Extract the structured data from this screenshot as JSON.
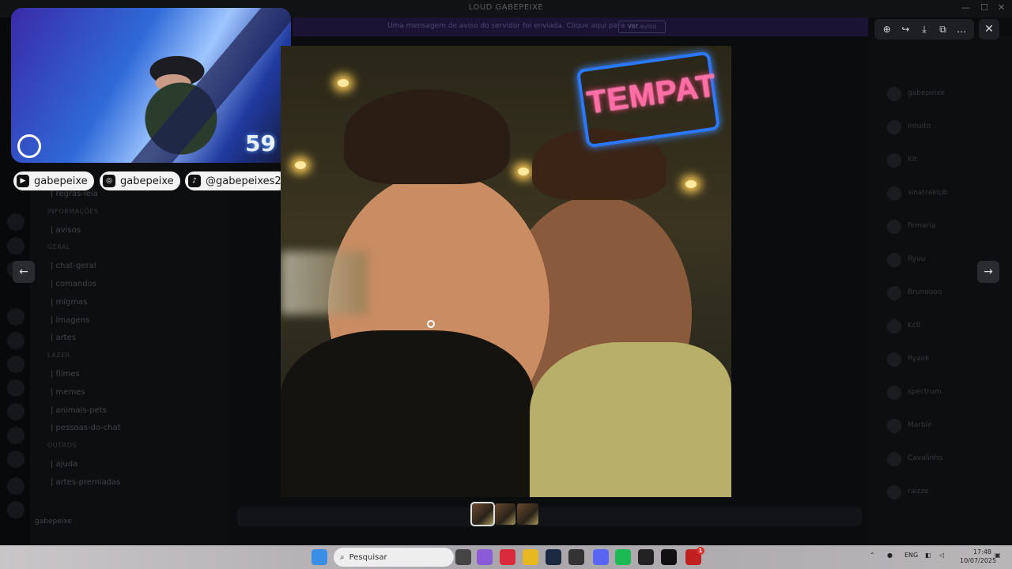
{
  "window": {
    "title": "LOUD GABEPEIXE",
    "minimize": "—",
    "maximize": "☐",
    "close": "✕"
  },
  "background": {
    "banner_text": "Uma mensagem de aviso do servidor foi enviada. Clique aqui para ver.",
    "banner_button": "Ver aviso",
    "channels": [
      {
        "label": "| regras-leia",
        "category": false
      },
      {
        "label": "INFORMAÇÕES",
        "category": true
      },
      {
        "label": "| avisos",
        "category": false
      },
      {
        "label": "GERAL",
        "category": true
      },
      {
        "label": "| chat-geral",
        "category": false
      },
      {
        "label": "| comandos",
        "category": false
      },
      {
        "label": "| mígmas",
        "category": false
      },
      {
        "label": "| imagens",
        "category": false
      },
      {
        "label": "| artes",
        "category": false
      },
      {
        "label": "LAZER",
        "category": true
      },
      {
        "label": "| filmes",
        "category": false
      },
      {
        "label": "| memes",
        "category": false
      },
      {
        "label": "| animais-pets",
        "category": false
      },
      {
        "label": "| pessoas-do-chat",
        "category": false
      },
      {
        "label": "OUTROS",
        "category": true
      },
      {
        "label": "| ajuda",
        "category": false
      },
      {
        "label": "| artes-premiadas",
        "category": false
      }
    ],
    "user_name": "gabepeixe",
    "members": [
      "gabepeixe",
      "Intuito",
      "Kit",
      "sinatraklub",
      "firmaria",
      "Ryuu",
      "Brunoooo",
      "Kcll",
      "Ryaok",
      "spectrum",
      "Marble",
      "Cavalinho",
      "raizzo"
    ]
  },
  "webcam": {
    "counter": "59"
  },
  "socials": [
    {
      "icon": "youtube-icon",
      "glyph": "▶",
      "handle": "gabepeixe"
    },
    {
      "icon": "instagram-icon",
      "glyph": "◎",
      "handle": "gabepeixe"
    },
    {
      "icon": "tiktok-icon",
      "glyph": "♪",
      "handle": "@gabepeixes2"
    }
  ],
  "image": {
    "neon_text": "TEMPAT"
  },
  "viewer": {
    "zoom": "⊕",
    "forward": "↪",
    "download": "⤓",
    "open": "⧉",
    "more": "…",
    "close": "✕",
    "prev": "←",
    "next": "→"
  },
  "taskbar": {
    "search_placeholder": "Pesquisar",
    "language": "ENG",
    "time": "17:48",
    "date": "10/07/2025",
    "badge": "1"
  }
}
